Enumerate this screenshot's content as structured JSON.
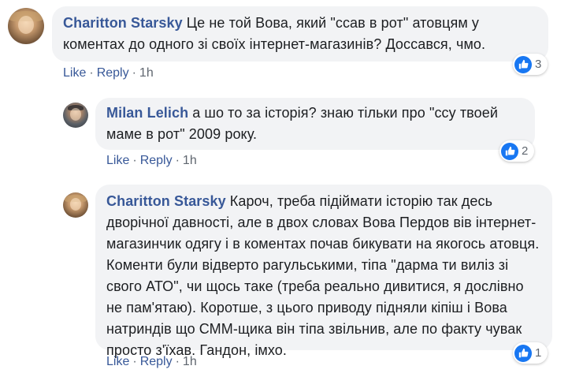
{
  "comments": [
    {
      "author": "Charitton Starsky",
      "text": "Це не той Вова, який \"ссав в рот\" атовцям у коментах до одного зі своїх інтернет-магазинів? Доссався, чмо.",
      "actions": {
        "like": "Like",
        "reply": "Reply",
        "time": "1h"
      },
      "reactions": {
        "icon": "thumbs-up-icon",
        "count": "3"
      }
    },
    {
      "author": "Milan Lelich",
      "text": "а шо то за історія? знаю тільки про \"ссу твоей маме в рот\" 2009 року.",
      "actions": {
        "like": "Like",
        "reply": "Reply",
        "time": "1h"
      },
      "reactions": {
        "icon": "thumbs-up-icon",
        "count": "2"
      }
    },
    {
      "author": "Charitton Starsky",
      "text": "Кароч, треба підіймати історію так десь дворічної давності, але в двох словах Вова Пердов вів інтернет-магазинчик одягу і в коментах почав бикувати на якогось атовця. Коменти були відверто рагульськими, тіпа \"дарма ти виліз зі свого АТО\", чи щось таке (треба реально дивитися, я дослівно не пам'ятаю). Коротше, з цього приводу підняли кіпіш і Вова натриндів що СММ-щика він тіпа звільнив, але по факту чувак просто з'їхав. Гандон, імхо.",
      "actions": {
        "like": "Like",
        "reply": "Reply",
        "time": "1h"
      },
      "reactions": {
        "icon": "thumbs-up-icon",
        "count": "1"
      }
    }
  ],
  "colors": {
    "author": "#385898",
    "bubble": "#f2f3f5",
    "like_badge": "#1877f2",
    "meta": "#606770"
  }
}
